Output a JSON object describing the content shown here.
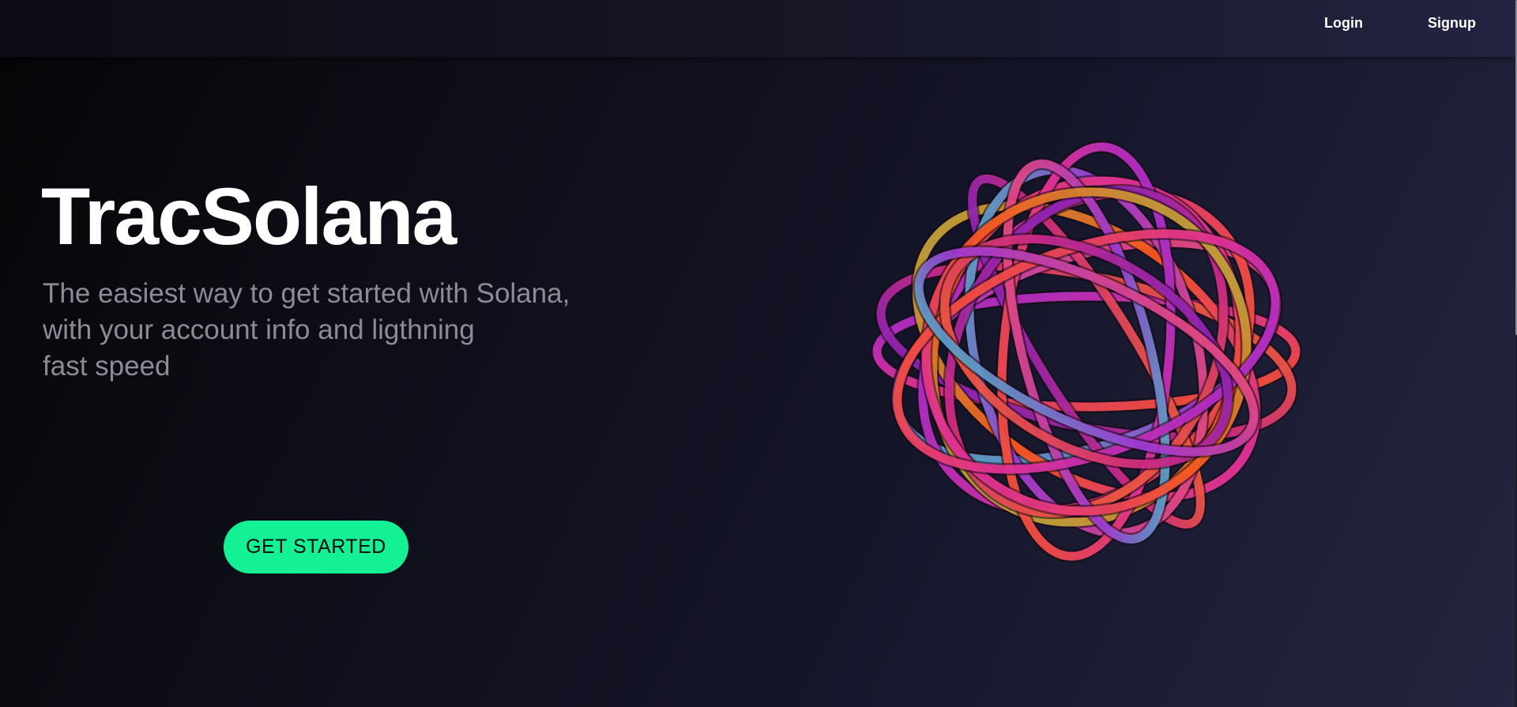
{
  "nav": {
    "login_label": "Login",
    "signup_label": "Signup"
  },
  "hero": {
    "title": "TracSolana",
    "subtitle_lines": [
      "The easiest way to get started with Solana,",
      "with your account info and ligthning",
      "fast speed"
    ],
    "cta_label": "GET STARTED",
    "art": "twisted-ribbon-sphere-illustration"
  },
  "colors": {
    "accent": "#14f195",
    "subtitle_text": "#8c8c96",
    "ribbon_pink": "#e8339a",
    "ribbon_orange": "#ff5a1f",
    "ribbon_purple": "#9b2ce0",
    "ribbon_teal": "#3ad9c4"
  }
}
